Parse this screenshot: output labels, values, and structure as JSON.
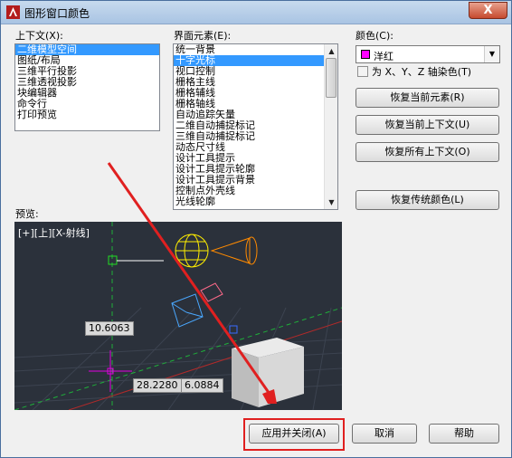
{
  "window": {
    "title": "图形窗口颜色",
    "close_symbol": "X"
  },
  "context": {
    "label": "上下文(X):",
    "items": [
      "二维模型空间",
      "图纸/布局",
      "三维平行投影",
      "三维透视投影",
      "块编辑器",
      "命令行",
      "打印预览"
    ],
    "selected_index": 0
  },
  "interface": {
    "label": "界面元素(E):",
    "items": [
      "统一背景",
      "十字光标",
      "视口控制",
      "栅格主线",
      "栅格辅线",
      "栅格轴线",
      "自动追踪矢量",
      "二维自动捕捉标记",
      "三维自动捕捉标记",
      "动态尺寸线",
      "设计工具提示",
      "设计工具提示轮廓",
      "设计工具提示背景",
      "控制点外壳线",
      "光线轮廓"
    ],
    "selected_index": 1
  },
  "color": {
    "label": "颜色(C):",
    "value": "洋红",
    "swatch": "#ff00ff",
    "tint_label": "为 X、Y、Z 轴染色(T)"
  },
  "buttons": {
    "restore_element": "恢复当前元素(R)",
    "restore_context": "恢复当前上下文(U)",
    "restore_all": "恢复所有上下文(O)",
    "restore_classic": "恢复传统颜色(L)",
    "apply_close": "应用并关闭(A)",
    "cancel": "取消",
    "help": "帮助"
  },
  "preview": {
    "label": "预览:",
    "viewport_label": "[+][上][X-射线]",
    "dims": [
      "10.6063",
      "28.2280",
      "6.0884"
    ]
  },
  "colors": {
    "accent": "#3399ff",
    "highlight": "#e02020"
  }
}
